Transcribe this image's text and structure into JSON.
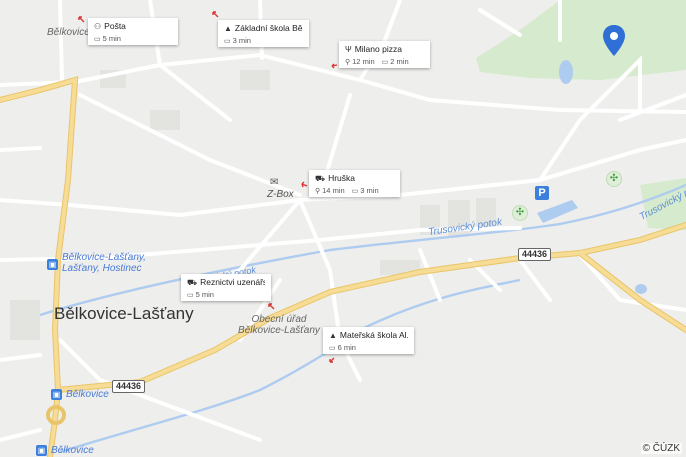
{
  "map": {
    "town": "Bělkovice-Lašťany",
    "village_top": "Bělkovice",
    "stream_1": "Trusovický potok",
    "stream_2": "Trusovický potok",
    "stream_3": "Trusovický potok",
    "road_number_1": "44436",
    "road_number_2": "44436",
    "stop_1_line1": "Bělkovice-Lašťany,",
    "stop_1_line2": "Lašťany, Hostinec",
    "stop_2": "Bělkovice",
    "stop_3": "Bělkovice",
    "office_line1": "Obecní úřad",
    "office_line2": "Bělkovice-Lašťany",
    "zbox": "Z-Box",
    "parking": "P",
    "copyright": "© ČÚZK"
  },
  "cards": {
    "posta": {
      "title": "Pošta",
      "icon": "post-office-icon",
      "drive": "5 min"
    },
    "zakladni": {
      "title": "Základní škola Bě...",
      "icon": "school-icon",
      "drive": "3 min"
    },
    "milano": {
      "title": "Milano pizza",
      "icon": "restaurant-icon",
      "walk": "12 min",
      "drive": "2 min"
    },
    "hruska": {
      "title": "Hruška",
      "icon": "shop-icon",
      "walk": "14 min",
      "drive": "3 min"
    },
    "reznictvi": {
      "title": "Reznictvi uzenářs...",
      "icon": "shop-icon",
      "drive": "5 min"
    },
    "materska": {
      "title": "Mateřská škola Al...",
      "icon": "school-icon",
      "drive": "6 min"
    }
  },
  "colors": {
    "background": "#eeeeec",
    "main_road": "#f6dc92",
    "water": "#aecbf0",
    "pin": "#2f6fd6",
    "park": "#d6eacd"
  }
}
